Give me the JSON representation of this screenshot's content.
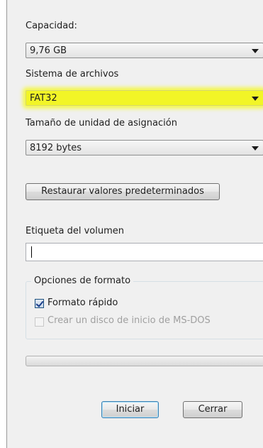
{
  "capacity": {
    "label": "Capacidad:",
    "value": "9,76 GB"
  },
  "filesystem": {
    "label": "Sistema de archivos",
    "value": "FAT32",
    "highlight_color": "#f2f527"
  },
  "allocation": {
    "label": "Tamaño de unidad de asignación",
    "value": "8192 bytes"
  },
  "restore_button": "Restaurar valores predeterminados",
  "volume_label": {
    "label": "Etiqueta del volumen",
    "value": ""
  },
  "format_options": {
    "legend": "Opciones de formato",
    "quick_format": {
      "label": "Formato rápido",
      "checked": true
    },
    "msdos_disk": {
      "label": "Crear un disco de inicio de MS-DOS",
      "checked": false,
      "enabled": false
    }
  },
  "progress": 0,
  "buttons": {
    "start": "Iniciar",
    "close": "Cerrar"
  },
  "icons": {
    "combo_arrow": "chevron-down-icon",
    "checkmark": "check-icon"
  }
}
